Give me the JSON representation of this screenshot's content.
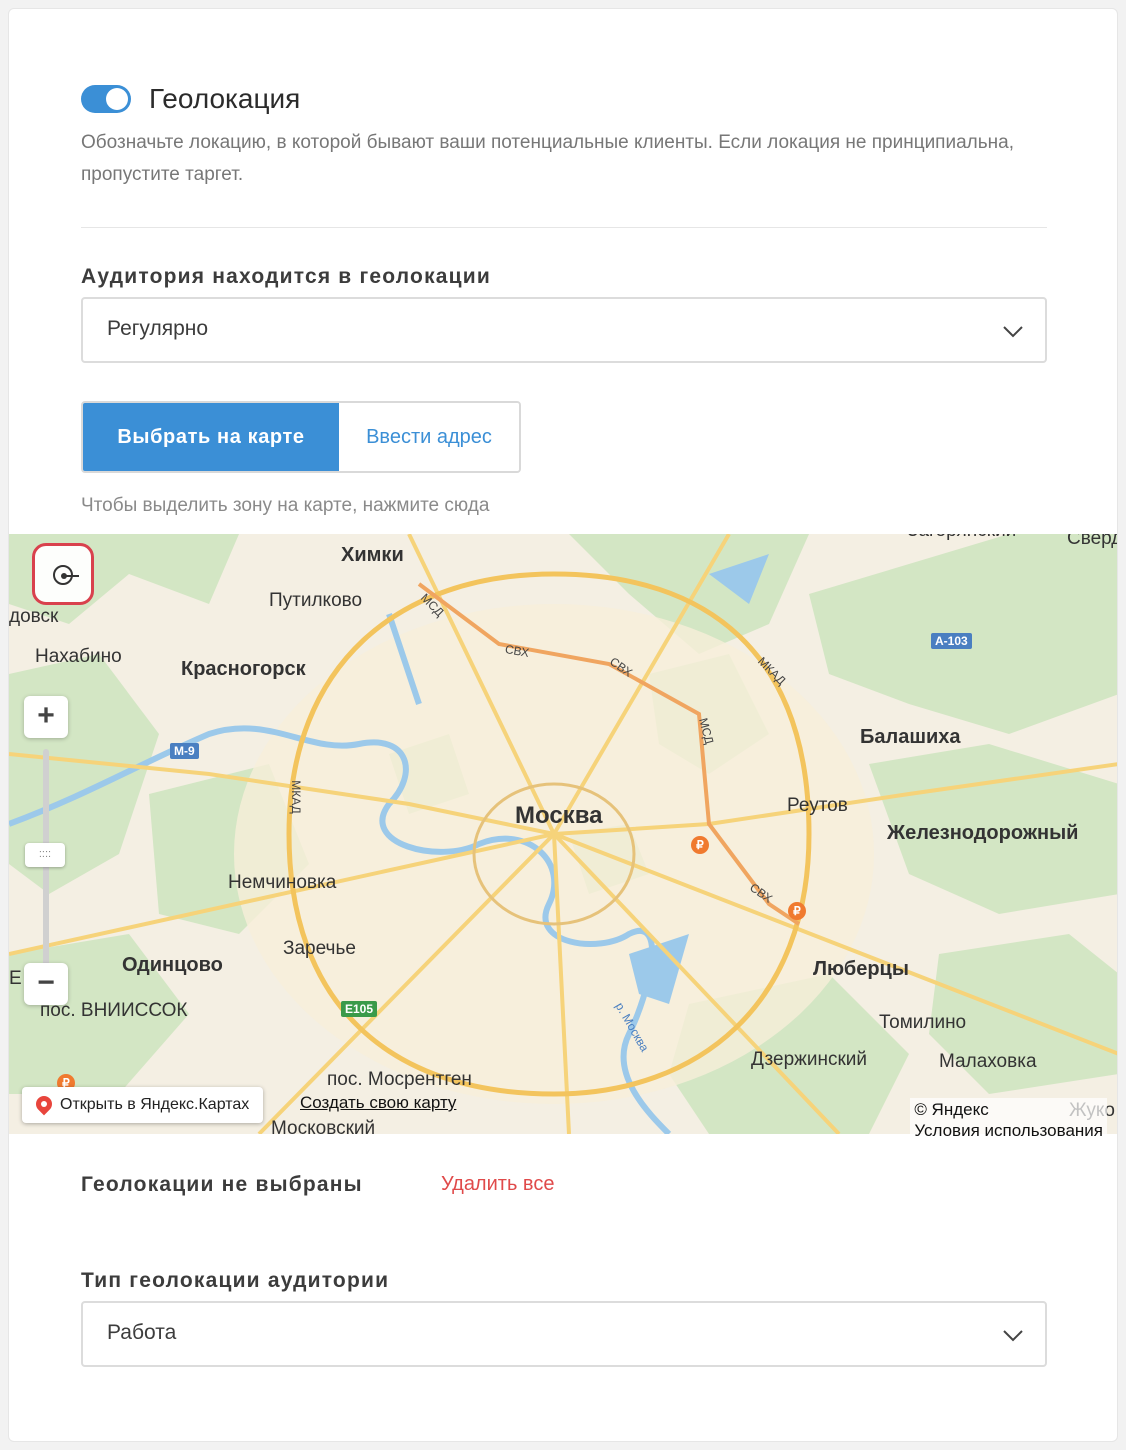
{
  "geolocation": {
    "toggle_on": true,
    "title": "Геолокация",
    "description": "Обозначьте локацию, в которой бывают ваши потенциальные клиенты. Если локация не принципиальна, пропустите таргет."
  },
  "audience_location": {
    "label": "Аудитория находится в геолокации",
    "selected": "Регулярно"
  },
  "mode_tabs": {
    "map": "Выбрать на карте",
    "address": "Ввести адрес"
  },
  "hint": "Чтобы выделить зону на карте, нажмите сюда",
  "map": {
    "cities": {
      "moscow": "Москва",
      "khimki": "Химки",
      "putilkovo": "Путилково",
      "krasnogorsk": "Красногорск",
      "nakhabino": "Нахабино",
      "balashikha": "Балашиха",
      "reutov": "Реутов",
      "zheleznodorozhny": "Железнодорожный",
      "nemchinovka": "Немчиновка",
      "zarechye": "Заречье",
      "odintsovo": "Одинцово",
      "vniissok": "пос. ВНИИССОК",
      "lyubertsy": "Люберцы",
      "tomilino": "Томилино",
      "dzerzhinsky": "Дзержинский",
      "malakhovka": "Малаховка",
      "mosrentgen": "пос. Мосрентген",
      "moskovsky": "Московский",
      "vsk": "довск",
      "ikha": "Е ха",
      "zhuko": "Жуко",
      "sverd": "Сверд",
      "zagoryansky": "Загорянский"
    },
    "roads": {
      "msd1": "МСД",
      "svh1": "СВХ",
      "svh2": "СВХ",
      "mkad1": "МКАД",
      "msd2": "МСД",
      "mkad2": "МКАД",
      "svh3": "СВХ",
      "river": "р. Москва"
    },
    "shields": {
      "a103": "А-103",
      "m9": "М-9",
      "e105": "Е105"
    },
    "open_yandex": "Открыть в Яндекс.Картах",
    "create_map": "Создать свою карту",
    "copyright": "© Яндекс",
    "terms": "Условия использования",
    "zoom_in": "+",
    "zoom_out": "−",
    "zoom_handle": "::::",
    "rub": "₽"
  },
  "selection": {
    "empty_label": "Геолокации не выбраны",
    "delete_all": "Удалить все"
  },
  "geo_type": {
    "label": "Тип геолокации аудитории",
    "selected": "Работа"
  },
  "colors": {
    "accent": "#3b8fd6",
    "danger": "#e04a4a"
  }
}
